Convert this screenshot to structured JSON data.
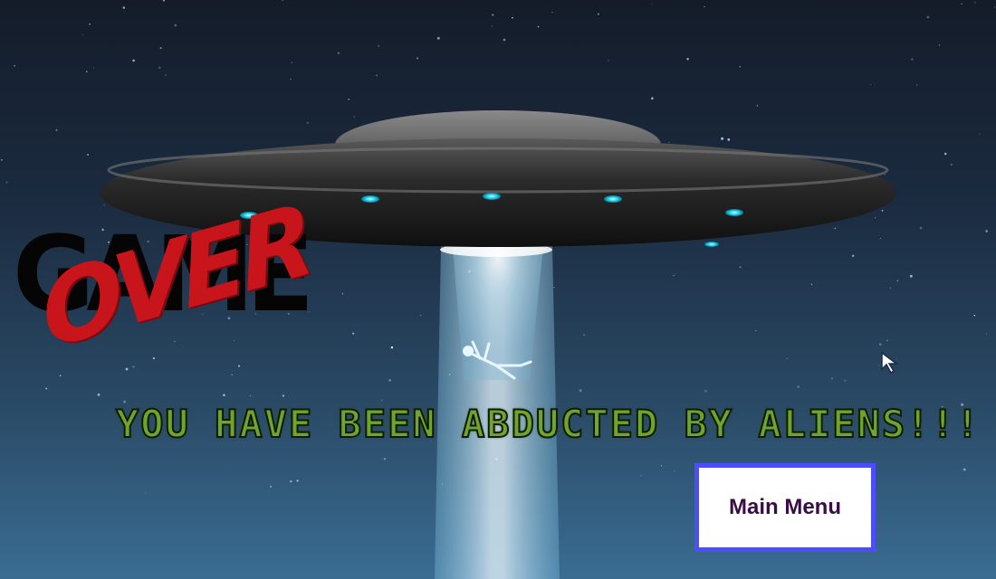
{
  "screen": {
    "title_word_1": "GAME",
    "title_word_2": "OVER",
    "message": "YOU HAVE BEEN ABDUCTED BY ALIENS!!!",
    "main_menu_label": "Main Menu"
  },
  "colors": {
    "button_border": "#4b4dff",
    "button_text": "#3a0d42",
    "message_fill": "#6fa52a",
    "over_red": "#c8151b",
    "ufo_light": "#16c8e6"
  },
  "icons": {
    "ufo": "ufo-icon",
    "abductee": "person-floating-icon",
    "cursor": "mouse-cursor-icon"
  }
}
